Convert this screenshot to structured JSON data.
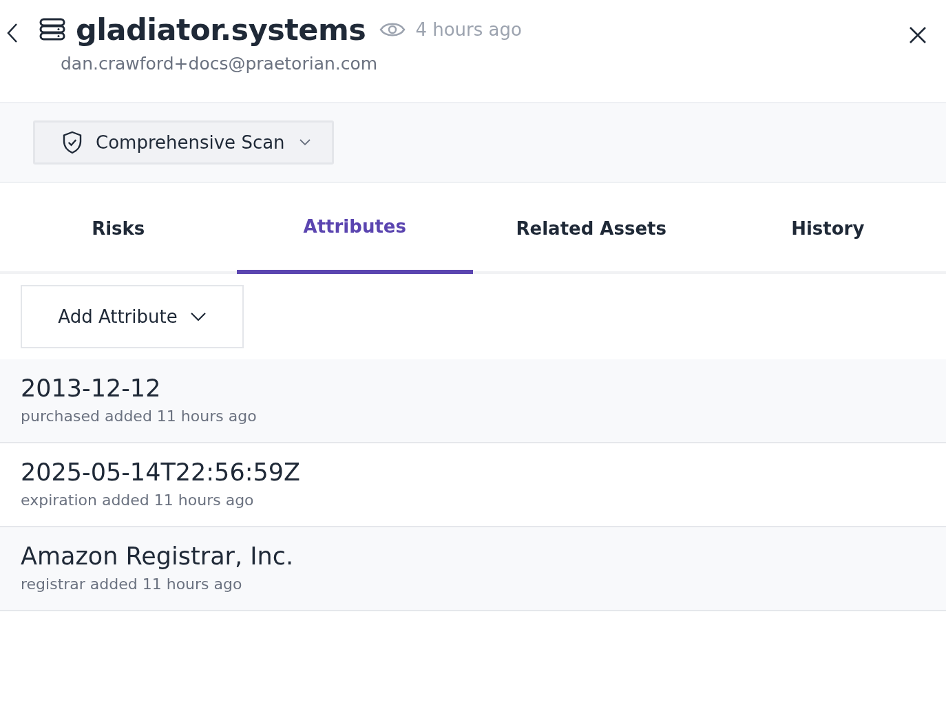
{
  "header": {
    "title": "gladiator.systems",
    "time": "4 hours ago",
    "email": "dan.crawford+docs@praetorian.com"
  },
  "scan_select": {
    "label": "Comprehensive Scan"
  },
  "tabs": [
    {
      "label": "Risks",
      "selected": false
    },
    {
      "label": "Attributes",
      "selected": true
    },
    {
      "label": "Related Assets",
      "selected": false
    },
    {
      "label": "History",
      "selected": false
    }
  ],
  "add_button": {
    "label": "Add Attribute"
  },
  "attributes": [
    {
      "value": "2013-12-12",
      "meta": "purchased added 11 hours ago"
    },
    {
      "value": "2025-05-14T22:56:59Z",
      "meta": "expiration added 11 hours ago"
    },
    {
      "value": "Amazon Registrar, Inc.",
      "meta": "registrar added 11 hours ago"
    }
  ]
}
